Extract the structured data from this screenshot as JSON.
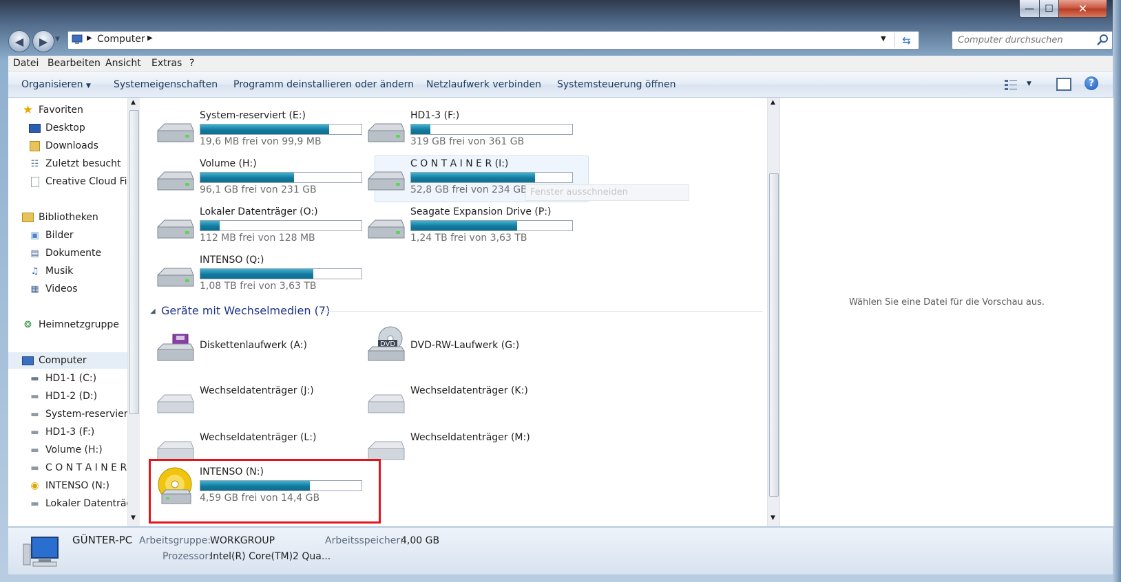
{
  "window": {
    "minimize_label": "—",
    "maximize_label": "☐",
    "close_label": "✕"
  },
  "address": {
    "path_label": "Computer",
    "search_placeholder": "Computer durchsuchen"
  },
  "menu": [
    "Datei",
    "Bearbeiten",
    "Ansicht",
    "Extras",
    "?"
  ],
  "commands": [
    "Organisieren",
    "Systemeigenschaften",
    "Programm deinstallieren oder ändern",
    "Netzlaufwerk verbinden",
    "Systemsteuerung öffnen"
  ],
  "nav": {
    "favorites": "Favoriten",
    "fav_items": [
      "Desktop",
      "Downloads",
      "Zuletzt besucht",
      "Creative Cloud Files"
    ],
    "libraries": "Bibliotheken",
    "lib_items": [
      "Bilder",
      "Dokumente",
      "Musik",
      "Videos"
    ],
    "homegroup": "Heimnetzgruppe",
    "computer": "Computer",
    "computer_items": [
      "HD1-1  (C:)",
      "HD1-2 (D:)",
      "System-reserviert (E:)",
      "HD1-3 (F:)",
      "Volume (H:)",
      "C O N T A I N E R (I:)",
      "INTENSO (N:)",
      "Lokaler Datenträger (O:)"
    ]
  },
  "hard_drives": [
    {
      "name": "System-reserviert (E:)",
      "free": "19,6 MB frei von 99,9 MB",
      "used_fraction": 0.8
    },
    {
      "name": "HD1-3 (F:)",
      "free": "319 GB frei von 361 GB",
      "used_fraction": 0.12
    },
    {
      "name": "Volume (H:)",
      "free": "96,1 GB frei von 231 GB",
      "used_fraction": 0.58
    },
    {
      "name": "C O N T A I N E R (I:)",
      "free": "52,8 GB frei von 234 GB",
      "used_fraction": 0.77
    },
    {
      "name": "Lokaler Datenträger (O:)",
      "free": "112 MB frei von 128 MB",
      "used_fraction": 0.12
    },
    {
      "name": "Seagate Expansion Drive (P:)",
      "free": "1,24 TB frei von 3,63 TB",
      "used_fraction": 0.66
    },
    {
      "name": "INTENSO (Q:)",
      "free": "1,08 TB frei von 3,63 TB",
      "used_fraction": 0.7
    }
  ],
  "tooltip": "Fenster ausschneiden",
  "removable_header": "Geräte mit Wechselmedien (7)",
  "removable": [
    {
      "name": "Diskettenlaufwerk (A:)",
      "icon": "floppy-drive-icon"
    },
    {
      "name": "DVD-RW-Laufwerk (G:)",
      "icon": "dvd-drive-icon"
    },
    {
      "name": "Wechseldatenträger (J:)",
      "icon": "removable-drive-icon"
    },
    {
      "name": "Wechseldatenträger (K:)",
      "icon": "removable-drive-icon"
    },
    {
      "name": "Wechseldatenträger (L:)",
      "icon": "removable-drive-icon"
    },
    {
      "name": "Wechseldatenträger (M:)",
      "icon": "removable-drive-icon"
    }
  ],
  "intenso_n": {
    "name": "INTENSO (N:)",
    "free": "4,59 GB frei von 14,4 GB",
    "used_fraction": 0.68
  },
  "dvd_label": "DVD",
  "highlight_color": "#e3141c",
  "preview_text": "Wählen Sie eine Datei für die Vorschau aus.",
  "status": {
    "pc_name": "GÜNTER-PC",
    "workgroup_label": "Arbeitsgruppe:",
    "workgroup_value": "WORKGROUP",
    "memory_label": "Arbeitsspeicher:",
    "memory_value": "4,00 GB",
    "cpu_label": "Prozessor:",
    "cpu_value": "Intel(R) Core(TM)2 Qua..."
  }
}
